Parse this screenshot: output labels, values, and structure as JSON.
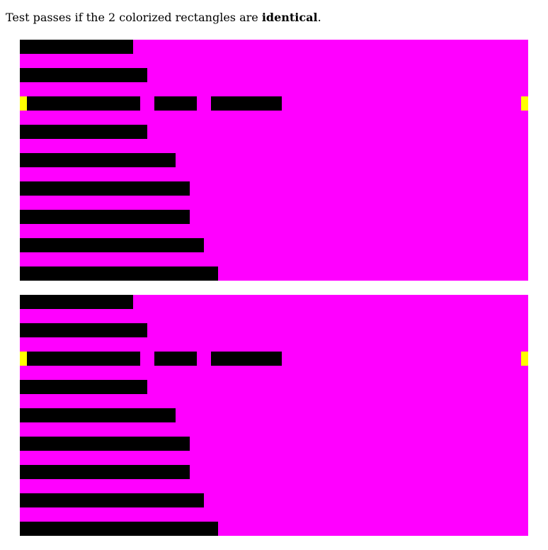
{
  "instructions": {
    "prefix": "Test passes if the 2 colorized rectangles are ",
    "emphasis": "identical",
    "suffix": "."
  },
  "colors": {
    "box_background": "#ff00ff",
    "bar": "#000000",
    "marker": "#ffff00",
    "page_background": "#ffffff"
  },
  "test_boxes": [
    {
      "name": "top-rectangle"
    },
    {
      "name": "bottom-rectangle"
    }
  ]
}
